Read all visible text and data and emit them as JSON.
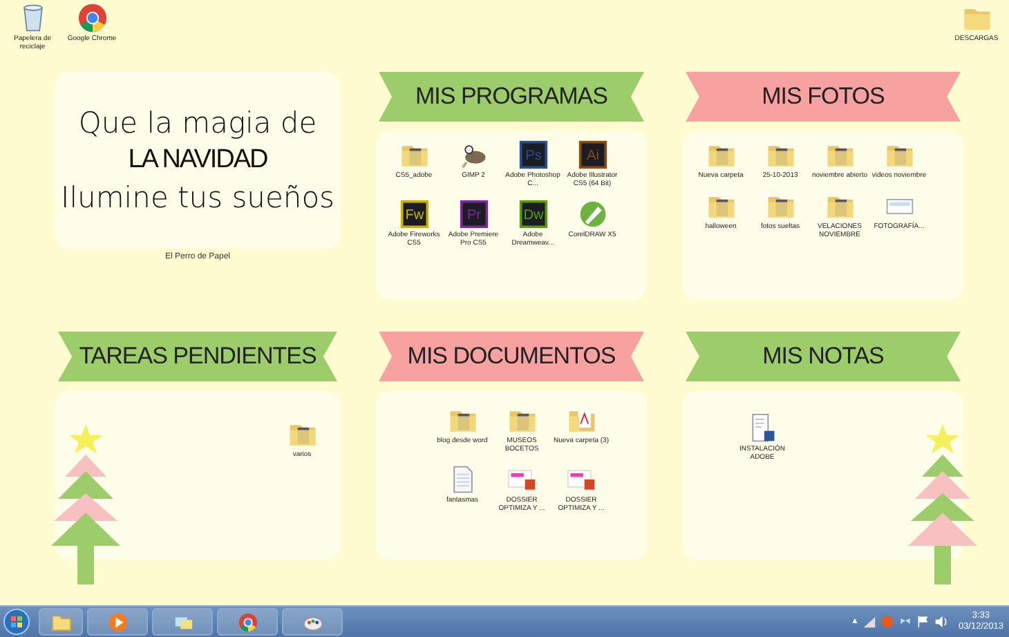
{
  "desktop_icons": [
    {
      "label": "Papelera de reciclaje",
      "kind": "recycle"
    },
    {
      "label": "Google Chrome",
      "kind": "chrome"
    },
    {
      "label": "DESCARGAS",
      "kind": "folder"
    }
  ],
  "quote": {
    "lines": [
      "Que la magia de",
      "LA NAVIDAD",
      "Ilumine tus sueños"
    ],
    "credit": "El Perro de Papel"
  },
  "sections": [
    {
      "title": "MIS PROGRAMAS",
      "color": "#9dcc6a",
      "icons": [
        {
          "label": "CS5_adobe",
          "kind": "folder"
        },
        {
          "label": "GIMP 2",
          "kind": "gimp"
        },
        {
          "label": "Adobe Photoshop C...",
          "kind": "app",
          "badge": "Ps",
          "color": "#2a4f8f"
        },
        {
          "label": "Adobe Illustrator CS5 (64 Bit)",
          "kind": "app",
          "badge": "Ai",
          "color": "#8a4a10"
        },
        {
          "label": "Adobe Fireworks CS5",
          "kind": "app",
          "badge": "Fw",
          "color": "#c8b400"
        },
        {
          "label": "Adobe Premiere Pro CS5",
          "kind": "app",
          "badge": "Pr",
          "color": "#7a2a9a"
        },
        {
          "label": "Adobe Dreamweav...",
          "kind": "app",
          "badge": "Dw",
          "color": "#5a9a10"
        },
        {
          "label": "CorelDRAW X5",
          "kind": "corel"
        }
      ]
    },
    {
      "title": "MIS FOTOS",
      "color": "#f7a1a1",
      "icons": [
        {
          "label": "Nueva carpeta",
          "kind": "folder"
        },
        {
          "label": "25-10-2013",
          "kind": "folder"
        },
        {
          "label": "noviembre abierto",
          "kind": "folder"
        },
        {
          "label": "videos noviembre",
          "kind": "folder"
        },
        {
          "label": "halloween",
          "kind": "folder"
        },
        {
          "label": "fotos sueltas",
          "kind": "folder"
        },
        {
          "label": "VELACIONES NOVIEMBRE",
          "kind": "folder"
        },
        {
          "label": "FOTOGRAFÍA...",
          "kind": "image"
        }
      ]
    },
    {
      "title": "TAREAS PENDIENTES",
      "color": "#9dcc6a",
      "icons": [
        {
          "label": "varios",
          "kind": "folder"
        }
      ]
    },
    {
      "title": "MIS DOCUMENTOS",
      "color": "#f7a1a1",
      "icons": [
        {
          "label": "blog desde word",
          "kind": "folder"
        },
        {
          "label": "MUSEOS BOCETOS",
          "kind": "folder"
        },
        {
          "label": "Nueva carpeta (3)",
          "kind": "pdf-folder"
        },
        {
          "label": "fantasmas",
          "kind": "text"
        },
        {
          "label": "DOSSIER OPTIMIZA Y ...",
          "kind": "ppt"
        },
        {
          "label": "DOSSIER OPTIMIZA Y ...",
          "kind": "ppt"
        }
      ]
    },
    {
      "title": "MIS NOTAS",
      "color": "#9dcc6a",
      "icons": [
        {
          "label": "INSTALACIÓN ADOBE",
          "kind": "word"
        }
      ]
    }
  ],
  "taskbar": {
    "items": [
      {
        "kind": "explorer"
      },
      {
        "kind": "media"
      },
      {
        "kind": "windows"
      },
      {
        "kind": "chrome"
      },
      {
        "kind": "paint"
      }
    ],
    "tray_arrow": "▲",
    "time": "3:33",
    "date": "03/12/2013"
  }
}
